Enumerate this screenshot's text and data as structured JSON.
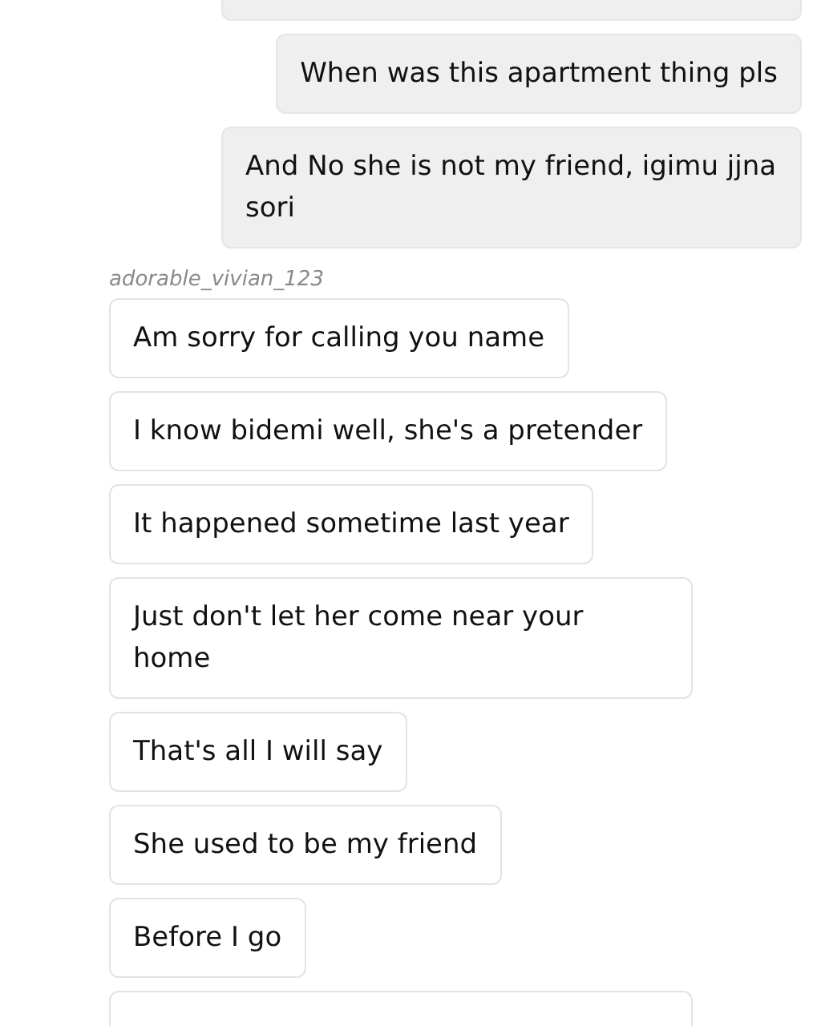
{
  "messages": [
    {
      "kind": "outgoing-clipped"
    },
    {
      "kind": "outgoing",
      "text": "When was this apartment thing pls"
    },
    {
      "kind": "outgoing",
      "text": "And No she is not my friend, igimu jjna sori"
    },
    {
      "kind": "sender",
      "text": "adorable_vivian_123"
    },
    {
      "kind": "incoming",
      "text": "Am sorry for calling you name"
    },
    {
      "kind": "incoming",
      "text": "I know bidemi well, she's a pretender"
    },
    {
      "kind": "incoming",
      "text": "It happened sometime last year"
    },
    {
      "kind": "incoming",
      "text": "Just don't let her come near your home"
    },
    {
      "kind": "incoming",
      "text": "That's all I will say"
    },
    {
      "kind": "incoming",
      "text": "She used to be my friend"
    },
    {
      "kind": "incoming",
      "text": "Before I go"
    },
    {
      "kind": "incoming-clipped"
    }
  ]
}
